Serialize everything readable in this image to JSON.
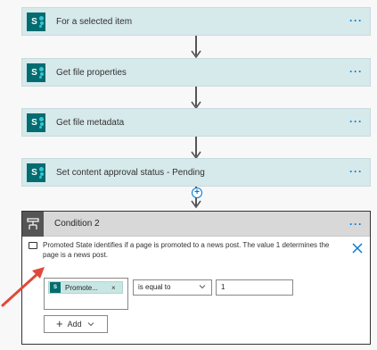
{
  "steps": [
    {
      "title": "For a selected item",
      "icon": "sharepoint-icon",
      "more": "···"
    },
    {
      "title": "Get file properties",
      "icon": "sharepoint-icon",
      "more": "···"
    },
    {
      "title": "Get file metadata",
      "icon": "sharepoint-icon",
      "more": "···"
    },
    {
      "title": "Set content approval status - Pending",
      "icon": "sharepoint-icon",
      "more": "···"
    }
  ],
  "insert_step": {
    "symbol": "+"
  },
  "condition": {
    "title": "Condition 2",
    "icon": "condition-icon",
    "more": "···",
    "note": "Promoted State identifies if a page is promoted to a news post. The value 1 determines the page is a news post.",
    "token_label": "Promote...",
    "token_remove": "×",
    "operator": "is equal to",
    "value": "1",
    "add_label": "Add",
    "add_symbol": "+"
  },
  "colors": {
    "step_background": "#d6e9eb",
    "sharepoint": "#036c70",
    "accent": "#0078d4",
    "annotation_arrow": "#e0493a"
  }
}
